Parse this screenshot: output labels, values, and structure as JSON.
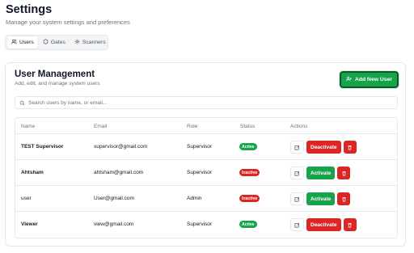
{
  "page": {
    "title": "Settings",
    "subtitle": "Manage your system settings and preferences"
  },
  "tabs": [
    {
      "label": "Users",
      "icon": "users-icon",
      "active": true
    },
    {
      "label": "Gates",
      "icon": "gate-icon",
      "active": false
    },
    {
      "label": "Scanners",
      "icon": "gear-icon",
      "active": false
    }
  ],
  "card": {
    "title": "User Management",
    "subtitle": "Add, edit, and manage system users",
    "add_button_label": "Add New User",
    "add_button_icon": "user-plus-icon"
  },
  "search": {
    "placeholder": "Search users by name, or email...",
    "value": ""
  },
  "table": {
    "columns": [
      "Name",
      "Email",
      "Role",
      "Status",
      "Actions"
    ],
    "rows": [
      {
        "name": "TEST Supervisor",
        "email": "supervisor@gmail.com",
        "role": "Supervisor",
        "status": "Active",
        "action": "Deactivate"
      },
      {
        "name": "Ahtsham",
        "email": "ahtsham@gmail.com",
        "role": "Supervisor",
        "status": "Inactive",
        "action": "Activate"
      },
      {
        "name": "user",
        "email": "User@gmail.com",
        "role": "Admin",
        "status": "Inactive",
        "action": "Activate"
      },
      {
        "name": "Viewer",
        "email": "view@gmail.com",
        "role": "Supervisor",
        "status": "Active",
        "action": "Deactivate"
      }
    ]
  },
  "colors": {
    "accent_green": "#16a34a",
    "danger_red": "#dc2626",
    "muted_text": "#6b7280",
    "border": "#e5e7eb"
  }
}
